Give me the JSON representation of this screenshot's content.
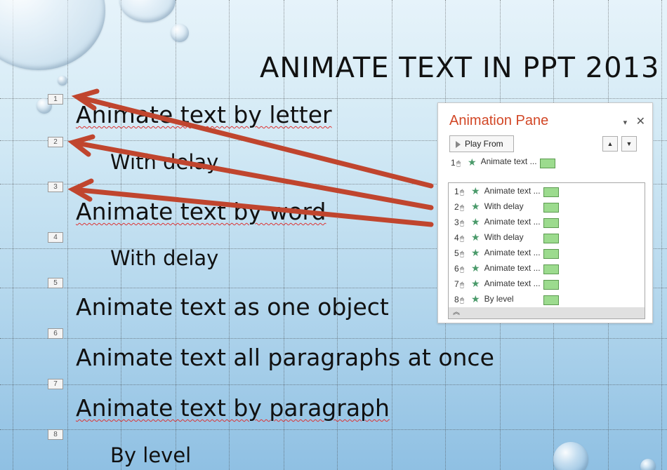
{
  "slide": {
    "title": "ANIMATE TEXT IN PPT 2013",
    "tags": [
      "1",
      "2",
      "3",
      "4",
      "5",
      "6",
      "7",
      "8"
    ],
    "paragraphs": [
      {
        "text": "Animate text by letter"
      },
      {
        "text": "With delay"
      },
      {
        "text": "Animate text by word"
      },
      {
        "text": "With delay"
      },
      {
        "text": "Animate text as one object"
      },
      {
        "text": "Animate text all paragraphs at once"
      },
      {
        "text": "Animate text by paragraph"
      },
      {
        "text": "By level"
      }
    ]
  },
  "pane": {
    "title": "Animation Pane",
    "dropdown_icon": "chevron-down-icon",
    "close_icon": "close-icon",
    "play_from_label": "Play From",
    "move_up_icon": "triangle-up-icon",
    "move_down_icon": "triangle-down-icon",
    "selected": {
      "num": "1",
      "label": "Animate text ..."
    },
    "items": [
      {
        "num": "1",
        "label": "Animate text ..."
      },
      {
        "num": "2",
        "label": "With delay"
      },
      {
        "num": "3",
        "label": "Animate text ..."
      },
      {
        "num": "4",
        "label": "With delay"
      },
      {
        "num": "5",
        "label": "Animate text ..."
      },
      {
        "num": "6",
        "label": "Animate text ..."
      },
      {
        "num": "7",
        "label": "Animate text ..."
      },
      {
        "num": "8",
        "label": "By level"
      }
    ],
    "timing_bar_color": "#9cdb8e",
    "expand_icon": "double-chevron-up-icon"
  },
  "colors": {
    "arrow": "#c0452e",
    "pane_title": "#d24726",
    "star": "#4a9a6a"
  }
}
